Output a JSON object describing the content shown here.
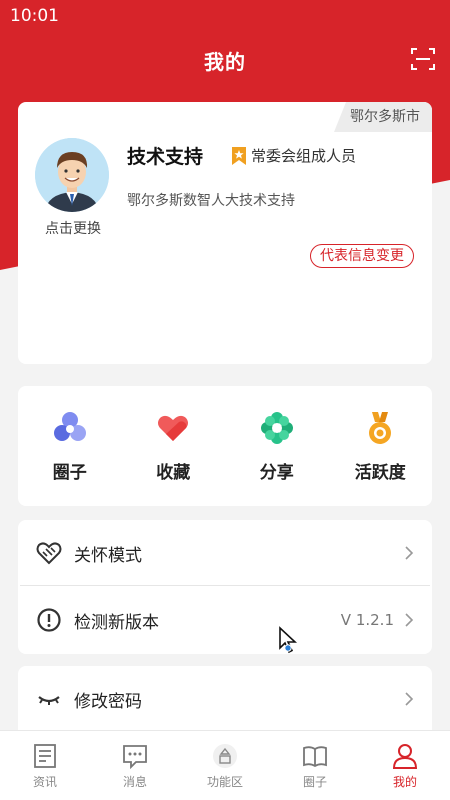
{
  "status_bar": {
    "time": "10:01"
  },
  "header": {
    "title": "我的",
    "scan_icon": "scan-icon"
  },
  "profile": {
    "city": "鄂尔多斯市",
    "avatar_icon": "avatar-icon",
    "change_avatar_label": "点击更换",
    "name": "技术支持",
    "role": "常委会组成人员",
    "description": "鄂尔多斯数智人大技术支持",
    "change_info_label": "代表信息变更"
  },
  "features": [
    {
      "label": "圈子",
      "icon": "circle-icon"
    },
    {
      "label": "收藏",
      "icon": "heart-icon"
    },
    {
      "label": "分享",
      "icon": "share-icon"
    },
    {
      "label": "活跃度",
      "icon": "medal-icon"
    }
  ],
  "settings": {
    "care_mode_label": "关怀模式",
    "check_update_label": "检测新版本",
    "version": "V 1.2.1",
    "change_password_label": "修改密码"
  },
  "tabbar": [
    {
      "label": "资讯",
      "icon": "news-icon",
      "active": false
    },
    {
      "label": "消息",
      "icon": "message-icon",
      "active": false
    },
    {
      "label": "功能区",
      "icon": "function-icon",
      "active": false
    },
    {
      "label": "圈子",
      "icon": "book-icon",
      "active": false
    },
    {
      "label": "我的",
      "icon": "profile-icon",
      "active": true
    }
  ],
  "colors": {
    "brand": "#d7242a",
    "background": "#f3f3f3",
    "badge": "#f0a020"
  }
}
